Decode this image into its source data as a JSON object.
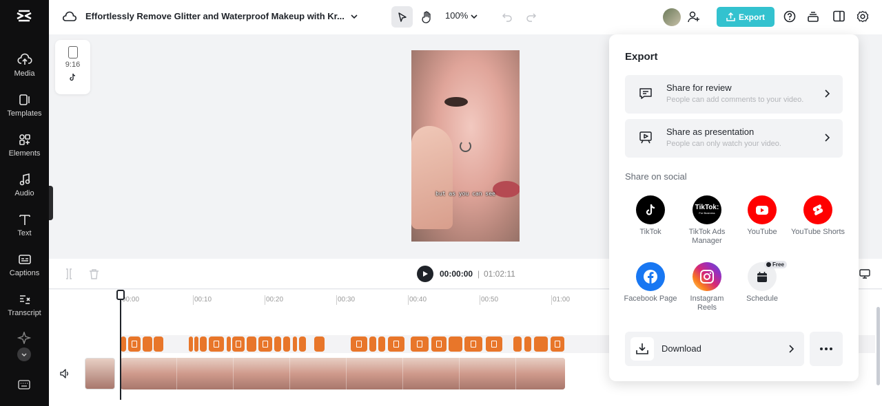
{
  "sidebar": {
    "items": [
      {
        "label": "Media",
        "icon": "cloud-upload-icon"
      },
      {
        "label": "Templates",
        "icon": "templates-icon"
      },
      {
        "label": "Elements",
        "icon": "elements-icon"
      },
      {
        "label": "Audio",
        "icon": "music-note-icon"
      },
      {
        "label": "Text",
        "icon": "text-t-icon"
      },
      {
        "label": "Captions",
        "icon": "captions-icon"
      },
      {
        "label": "Transcript",
        "icon": "transcript-icon"
      }
    ]
  },
  "topbar": {
    "project_title": "Effortlessly Remove Glitter and Waterproof Makeup with Kr...",
    "zoom": "100%",
    "export_label": "Export"
  },
  "canvas": {
    "ratio": "9:16",
    "subtitle": "but as you can see"
  },
  "timeline": {
    "current_time": "00:00:00",
    "separator": "|",
    "total_time": "01:02:11",
    "ruler": [
      "00:00",
      "00:10",
      "00:20",
      "00:30",
      "00:40",
      "00:50",
      "01:00"
    ]
  },
  "export_panel": {
    "title": "Export",
    "share_review": {
      "title": "Share for review",
      "subtitle": "People can add comments to your video."
    },
    "share_presentation": {
      "title": "Share as presentation",
      "subtitle": "People can only watch your video."
    },
    "social_heading": "Share on social",
    "social": [
      {
        "label": "TikTok",
        "color": "#000000"
      },
      {
        "label": "TikTok Ads Manager",
        "color": "#000000",
        "logo_text": "TikTok:",
        "logo_sub": "For Business"
      },
      {
        "label": "YouTube",
        "color": "#ff0000"
      },
      {
        "label": "YouTube Shorts",
        "color": "#ff0000"
      },
      {
        "label": "Facebook Page",
        "color": "#1877f2"
      },
      {
        "label": "Instagram Reels",
        "color": "#d62976"
      },
      {
        "label": "Schedule",
        "color": "#eeeeee"
      }
    ],
    "free_badge": "Free",
    "download_label": "Download"
  },
  "colors": {
    "accent": "#33c2cf",
    "caption_clip": "#e8762a"
  }
}
